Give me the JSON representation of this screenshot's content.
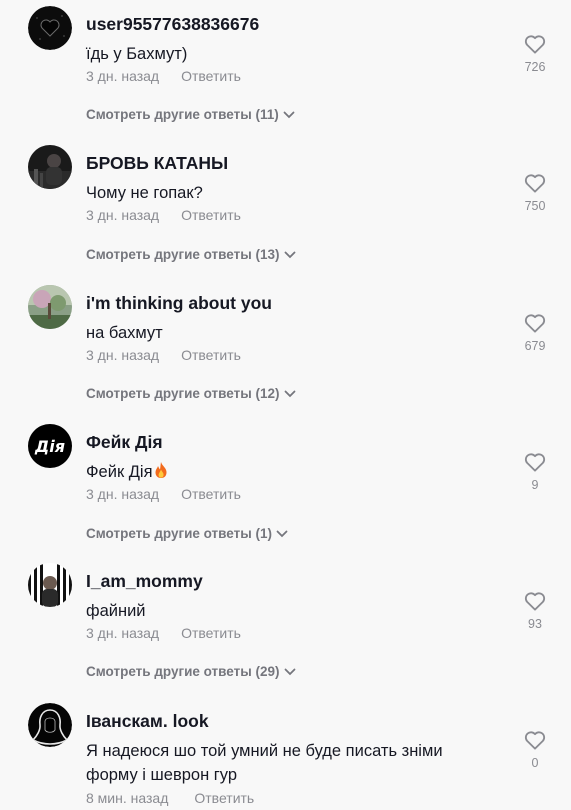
{
  "labels": {
    "reply": "Ответить",
    "more_prefix": "Смотреть другие ответы"
  },
  "comments": [
    {
      "username": "user95577638836676",
      "text": "їдь у Бахмут)",
      "time": "3 дн. назад",
      "likes": "726",
      "more": "Смотреть другие ответы (11)",
      "avatar_icon": "black-heart-avatar-icon"
    },
    {
      "username": "БРОВЬ КАТАНЫ",
      "text": "Чому не гопак?",
      "time": "3 дн. назад",
      "likes": "750",
      "more": "Смотреть другие ответы (13)",
      "avatar_icon": "dark-photo-avatar-icon"
    },
    {
      "username": "i'm thinking about you",
      "text": "на бахмут",
      "time": "3 дн. назад",
      "likes": "679",
      "more": "Смотреть другие ответы (12)",
      "avatar_icon": "nature-photo-avatar-icon"
    },
    {
      "username": "Фейк Дія",
      "text": "Фейк Дія",
      "text_emoji": "fire-icon",
      "time": "3 дн. назад",
      "likes": "9",
      "more": "Смотреть другие ответы (1)",
      "avatar_text": "Дія"
    },
    {
      "username": "I_am_mommy",
      "text": "файний",
      "time": "3 дн. назад",
      "likes": "93",
      "more": "Смотреть другие ответы (29)",
      "avatar_icon": "striped-photo-avatar-icon"
    },
    {
      "username": "Іванскам. look",
      "text_line1": "Я надеюся шо той умний не буде писать зніми",
      "text_line2": "форму і шеврон гур",
      "time": "8 мин. назад",
      "likes": "0",
      "avatar_icon": "hooded-figure-avatar-icon"
    }
  ],
  "colors": {
    "background": "#f8f8f8",
    "username": "#161823",
    "meta": "#8a8b91",
    "more": "#75767d"
  }
}
